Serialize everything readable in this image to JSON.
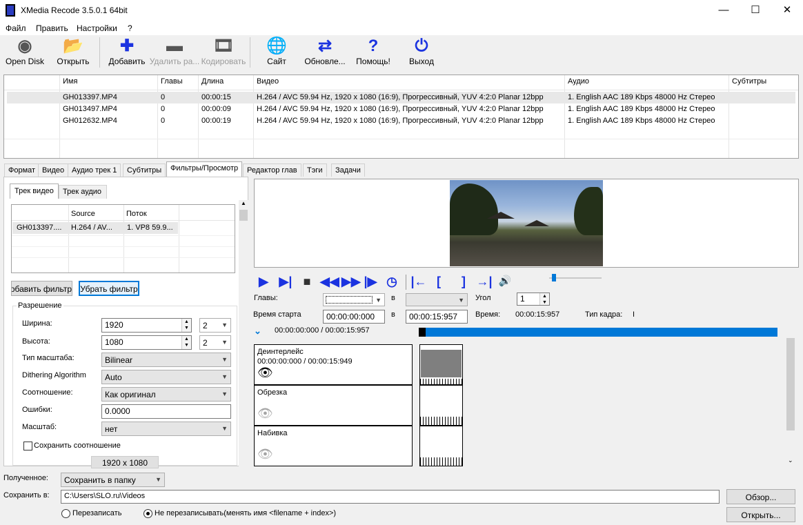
{
  "window": {
    "title": "XMedia Recode 3.5.0.1 64bit",
    "min": "—",
    "max": "☐",
    "close": "✕"
  },
  "menu": [
    "Файл",
    "Править",
    "Настройки",
    "?"
  ],
  "toolbar": [
    {
      "label": "Open Disk",
      "icon": "disc-icon",
      "glyph": "◉",
      "enabled": true
    },
    {
      "label": "Открыть",
      "icon": "folder-open-icon",
      "glyph": "📂",
      "enabled": true
    },
    {
      "label": "Добавить",
      "icon": "plus-icon",
      "glyph": "✚",
      "enabled": true
    },
    {
      "label": "Удалить ра...",
      "icon": "minus-icon",
      "glyph": "▬",
      "enabled": false
    },
    {
      "label": "Кодировать",
      "icon": "film-icon",
      "glyph": "🎞",
      "enabled": false
    },
    {
      "label": "Сайт",
      "icon": "globe-icon",
      "glyph": "🌐",
      "enabled": true
    },
    {
      "label": "Обновле...",
      "icon": "refresh-icon",
      "glyph": "⇄",
      "enabled": true
    },
    {
      "label": "Помощь!",
      "icon": "help-icon",
      "glyph": "?",
      "enabled": true
    },
    {
      "label": "Выход",
      "icon": "power-icon",
      "glyph": "⏻",
      "enabled": true
    }
  ],
  "filelist": {
    "headers": [
      "Имя",
      "Главы",
      "Длина",
      "Видео",
      "Аудио",
      "Субтитры"
    ],
    "rows": [
      [
        "GH013397.MP4",
        "0",
        "00:00:15",
        "H.264 / AVC  59.94 Hz, 1920 x 1080 (16:9), Прогрессивный, YUV 4:2:0 Planar 12bpp",
        "1. English AAC  189 Kbps 48000 Hz Стерео",
        ""
      ],
      [
        "GH013497.MP4",
        "0",
        "00:00:09",
        "H.264 / AVC  59.94 Hz, 1920 x 1080 (16:9), Прогрессивный, YUV 4:2:0 Planar 12bpp",
        "1. English AAC  189 Kbps 48000 Hz Стерео",
        ""
      ],
      [
        "GH012632.MP4",
        "0",
        "00:00:19",
        "H.264 / AVC  59.94 Hz, 1920 x 1080 (16:9), Прогрессивный, YUV 4:2:0 Planar 12bpp",
        "1. English AAC  189 Kbps 48000 Hz Стерео",
        ""
      ]
    ]
  },
  "tabs": [
    "Формат",
    "Видео",
    "Аудио трек 1",
    "Субтитры",
    "Фильтры/Просмотр",
    "Редактор глав",
    "Тэги",
    "Задачи"
  ],
  "subtabs": [
    "Трек видео",
    "Трек аудио"
  ],
  "tracktable": {
    "headers": [
      "Source",
      "Поток"
    ],
    "row": [
      "GH013397....",
      "H.264 / AV...",
      "1. VP8 59.9..."
    ]
  },
  "buttons": {
    "add_filter": "Добавить фильтр",
    "remove_filter": "Убрать фильтр",
    "browse": "Обзор...",
    "open": "Открыть..."
  },
  "resolution": {
    "group": "Разрешение",
    "width_label": "Ширина:",
    "width": "1920",
    "width_div": "2",
    "height_label": "Высота:",
    "height": "1080",
    "height_div": "2",
    "scale_type_label": "Тип масштаба:",
    "scale_type": "Bilinear",
    "dither_label": "Dithering Algorithm",
    "dither": "Auto",
    "ratio_label": "Соотношение:",
    "ratio": "Как оригинал",
    "errors_label": "Ошибки:",
    "errors": "0.0000",
    "scale_label": "Масштаб:",
    "scale": "нет",
    "keep_ratio": "Сохранить соотношение",
    "size_display": "1920 x 1080"
  },
  "player": {
    "chapters_label": "Главы:",
    "in_label": "в",
    "angle_label": "Угол",
    "angle": "1",
    "start_label": "Время старта",
    "start": "00:00:00:000",
    "end": "00:00:15:957",
    "time_label": "Время:",
    "time": "00:00:15:957",
    "frame_type_label": "Тип кадра:",
    "frame_type": "I",
    "position": "00:00:00:000 / 00:00:15:957",
    "progress": 1.0
  },
  "filters": [
    {
      "name": "Деинтерлейс",
      "time": "00:00:00:000 / 00:00:15:949",
      "active": true
    },
    {
      "name": "Обрезка",
      "time": "",
      "active": false
    },
    {
      "name": "Набивка",
      "time": "",
      "active": false
    }
  ],
  "bottom": {
    "output_label": "Полученное:",
    "output": "Сохранить в папку",
    "save_label": "Сохранить в:",
    "save_path": "C:\\Users\\SLO.ru\\Videos",
    "overwrite": "Перезаписать",
    "no_overwrite": "Не перезаписывать(менять имя <filename + index>)"
  },
  "colors": {
    "accent": "#1b33e0",
    "progress": "#0078d7"
  }
}
